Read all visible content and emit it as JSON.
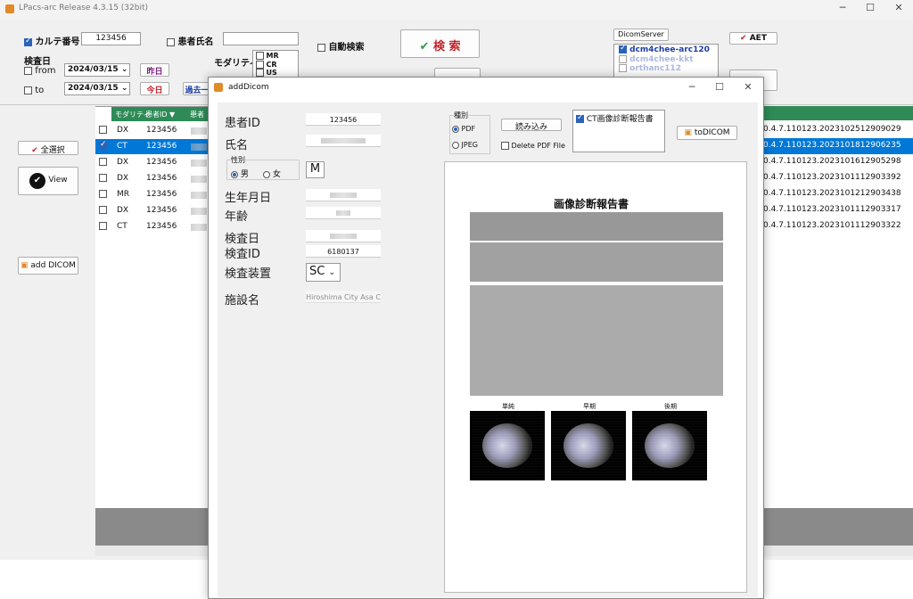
{
  "app": {
    "title": "LPacs-arc  Release 4.3.15 (32bit)"
  },
  "search": {
    "karte_label": "カルテ番号",
    "karte_value": "123456",
    "patient_name_label": "患者氏名",
    "patient_name_value": "",
    "exam_date_label": "検査日",
    "from_label": "from",
    "to_label": "to",
    "from_date": "2024/03/15",
    "to_date": "2024/03/15",
    "yesterday_btn": "昨日",
    "today_btn": "今日",
    "past_btn": "過去一",
    "modality_label": "モダリティ",
    "modality_options": [
      "MR",
      "CR",
      "US"
    ],
    "auto_search_label": "自動検索",
    "search_btn": "検 索"
  },
  "dicom_server": {
    "tab_label": "DicomServer",
    "servers": [
      "dcm4chee-arc120",
      "dcm4chee-kkt",
      "orthanc112"
    ],
    "aet_btn": "AET"
  },
  "left_panel": {
    "select_all_btn": "全選択",
    "view_btn": "View",
    "add_dicom_btn": "add DICOM"
  },
  "grid": {
    "headers": [
      "モダリティ",
      "患者ID ▼",
      "患者"
    ],
    "rows": [
      {
        "modality": "DX",
        "pid": "123456",
        "uid": "0.4.7.110123.2023102512909029",
        "selected": false
      },
      {
        "modality": "CT",
        "pid": "123456",
        "uid": "0.4.7.110123.2023101812906235",
        "selected": true
      },
      {
        "modality": "DX",
        "pid": "123456",
        "uid": "0.4.7.110123.2023101612905298",
        "selected": false
      },
      {
        "modality": "DX",
        "pid": "123456",
        "uid": "0.4.7.110123.2023101112903392",
        "selected": false
      },
      {
        "modality": "MR",
        "pid": "123456",
        "uid": "0.4.7.110123.2023101212903438",
        "selected": false
      },
      {
        "modality": "DX",
        "pid": "123456",
        "uid": "0.4.7.110123.2023101112903317",
        "selected": false
      },
      {
        "modality": "CT",
        "pid": "123456",
        "uid": "0.4.7.110123.2023101112903322",
        "selected": false
      }
    ]
  },
  "dialog": {
    "title": "addDicom",
    "patient_id_label": "患者ID",
    "patient_id_value": "123456",
    "name_label": "氏名",
    "gender_group": "性別",
    "male_label": "男",
    "female_label": "女",
    "gender_value": "M",
    "birth_label": "生年月日",
    "age_label": "年齢",
    "exam_date_label": "検査日",
    "exam_id_label": "検査ID",
    "exam_id_value": "6180137",
    "device_label": "検査装置",
    "device_value": "SC",
    "facility_label": "施設名",
    "facility_value": "Hiroshima City Asa C",
    "type_group": "種別",
    "pdf_label": "PDF",
    "jpeg_label": "JPEG",
    "load_btn": "読み込み",
    "delete_pdf_label": "Delete PDF File",
    "file_list_item": "CT画像診断報告書",
    "to_dicom_btn": "toDICOM",
    "report_title": "画像診断報告書",
    "image_captions": [
      "単純",
      "早期",
      "後期"
    ]
  }
}
